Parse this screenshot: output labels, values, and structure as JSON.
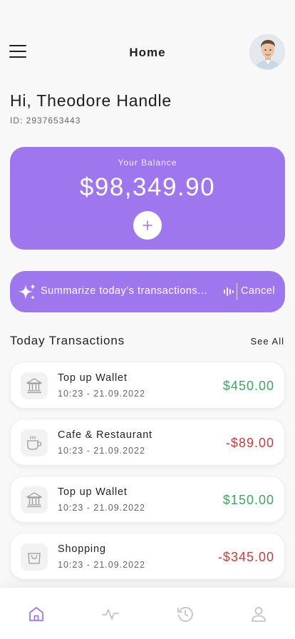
{
  "header": {
    "title": "Home"
  },
  "user": {
    "greeting": "Hi, Theodore Handle",
    "id": "ID: 2937653443"
  },
  "balance": {
    "label": "Your Balance",
    "amount": "$98,349.90"
  },
  "ai_bar": {
    "input_text": "Summarize today’s transactions...",
    "cancel_label": "Cancel"
  },
  "transactions_section": {
    "title": "Today Transactions",
    "see_all_label": "See All"
  },
  "transactions": [
    {
      "title": "Top up Wallet",
      "date": "10:23 - 21.09.2022",
      "amount": "$450.00",
      "icon": "bank-icon"
    },
    {
      "title": "Cafe & Restaurant",
      "date": "10:23 - 21.09.2022",
      "amount": "-$89.00",
      "icon": "cup-icon"
    },
    {
      "title": "Top up Wallet",
      "date": "10:23 - 21.09.2022",
      "amount": "$150.00",
      "icon": "bank-icon"
    },
    {
      "title": "Shopping",
      "date": "10:23 - 21.09.2022",
      "amount": "-$345.00",
      "icon": "shopping-bag-icon"
    }
  ],
  "bottom_nav": {
    "items": [
      {
        "icon": "home-icon",
        "active": true
      },
      {
        "icon": "activity-icon",
        "active": false
      },
      {
        "icon": "history-icon",
        "active": false
      },
      {
        "icon": "profile-icon",
        "active": false
      }
    ]
  },
  "colors": {
    "accent": "#9e76ee",
    "positive": "#3fa55f",
    "negative": "#c0403a",
    "background": "#f8f8f8"
  }
}
